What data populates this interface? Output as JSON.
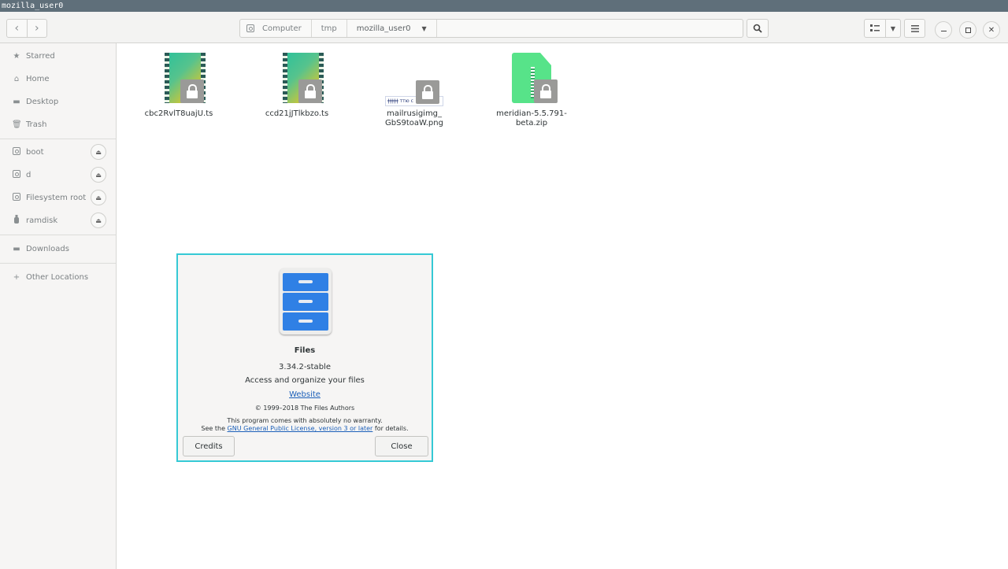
{
  "window": {
    "title": "mozilla_user0"
  },
  "nav": {
    "back_icon": "‹",
    "forward_icon": "›"
  },
  "pathbar": {
    "crumbs": [
      {
        "label": "Computer"
      },
      {
        "label": "tmp"
      },
      {
        "label": "mozilla_user0"
      }
    ]
  },
  "sidebar": {
    "items": [
      {
        "label": "Starred",
        "icon": "star-icon",
        "glyph": "★"
      },
      {
        "label": "Home",
        "icon": "home-icon",
        "glyph": "⌂"
      },
      {
        "label": "Desktop",
        "icon": "folder-icon",
        "glyph": "▬"
      },
      {
        "label": "Trash",
        "icon": "trash-icon",
        "glyph": "🗑"
      },
      {
        "label": "boot",
        "icon": "drive-icon"
      },
      {
        "label": "d",
        "icon": "drive-icon"
      },
      {
        "label": "Filesystem root",
        "icon": "drive-icon"
      },
      {
        "label": "ramdisk",
        "icon": "usb-icon",
        "glyph": "⚲"
      },
      {
        "label": "Downloads",
        "icon": "folder-icon",
        "glyph": "▬"
      },
      {
        "label": "Other Locations",
        "icon": "plus-icon",
        "glyph": "+"
      }
    ]
  },
  "files": [
    {
      "name": "cbc2RvlT8uajU.ts",
      "icon": "video-file-icon"
    },
    {
      "name": "ccd21jJTlkbzo.ts",
      "icon": "video-file-icon"
    },
    {
      "name": "mailrusigimg_\nGbS9toaW.png",
      "icon": "image-file-icon",
      "preview_text": "ǂǂǂǂǂ ттю с"
    },
    {
      "name": "meridian-5.5.791-\nbeta.zip",
      "icon": "zip-file-icon"
    }
  ],
  "about": {
    "app_name": "Files",
    "version": "3.34.2-stable",
    "description": "Access and organize your files",
    "website": "Website",
    "copyright": "© 1999–2018 The Files Authors",
    "warranty": "This program comes with absolutely no warranty.",
    "license_pre": "See the ",
    "license_link": "GNU General Public License, version 3 or later",
    "license_post": " for details.",
    "credits_button": "Credits",
    "close_button": "Close"
  }
}
